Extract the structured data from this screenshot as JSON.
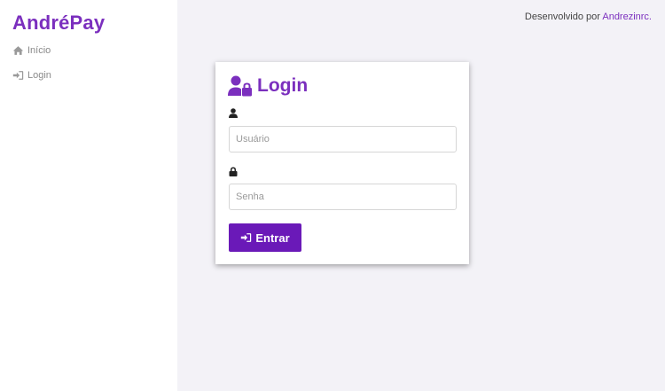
{
  "app": {
    "brand": "AndréPay"
  },
  "sidebar": {
    "items": [
      {
        "label": "Início",
        "icon": "home-icon"
      },
      {
        "label": "Login",
        "icon": "sign-in-icon"
      }
    ]
  },
  "header": {
    "credits_prefix": "Desenvolvido por ",
    "credits_link": "Andrezinrc."
  },
  "login": {
    "title": "Login",
    "title_icon": "user-lock-icon",
    "username_icon": "user-icon",
    "username_placeholder": "Usuário",
    "username_value": "",
    "password_icon": "lock-icon",
    "password_placeholder": "Senha",
    "password_value": "",
    "submit_label": "Entrar",
    "submit_icon": "sign-in-icon"
  },
  "colors": {
    "brand": "#7b2fbe",
    "button": "#6a19b8",
    "background": "#f3f2f7",
    "sidebar": "#ffffff"
  }
}
